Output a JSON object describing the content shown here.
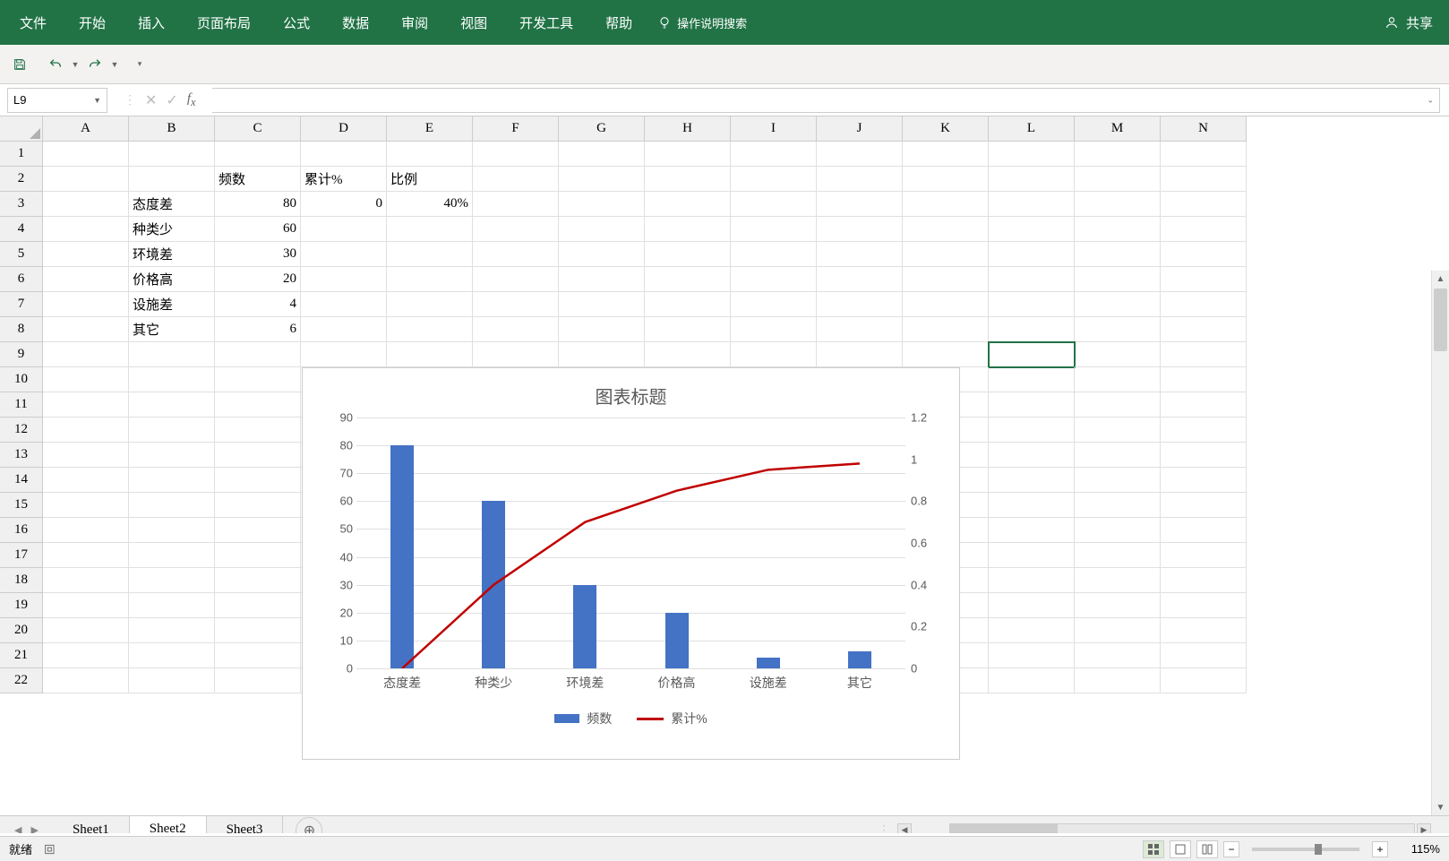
{
  "ribbon": {
    "items": [
      "文件",
      "开始",
      "插入",
      "页面布局",
      "公式",
      "数据",
      "审阅",
      "视图",
      "开发工具",
      "帮助"
    ],
    "tell_me": "操作说明搜索",
    "share": "共享"
  },
  "name_box": "L9",
  "formula": "",
  "columns": [
    "A",
    "B",
    "C",
    "D",
    "E",
    "F",
    "G",
    "H",
    "I",
    "J",
    "K",
    "L",
    "M",
    "N"
  ],
  "row_count": 22,
  "active_cell": {
    "col": 11,
    "row": 8
  },
  "table": {
    "headers": {
      "freq": "频数",
      "cum": "累计%",
      "ratio": "比例"
    },
    "rows": [
      {
        "label": "态度差",
        "freq": 80,
        "cum": 0,
        "ratio": "40%"
      },
      {
        "label": "种类少",
        "freq": 60
      },
      {
        "label": "环境差",
        "freq": 30
      },
      {
        "label": "价格高",
        "freq": 20
      },
      {
        "label": "设施差",
        "freq": 4
      },
      {
        "label": "其它",
        "freq": 6
      }
    ]
  },
  "chart_data": {
    "type": "combo-bar-line",
    "title": "图表标题",
    "categories": [
      "态度差",
      "种类少",
      "环境差",
      "价格高",
      "设施差",
      "其它"
    ],
    "series": [
      {
        "name": "频数",
        "type": "bar",
        "axis": "left",
        "values": [
          80,
          60,
          30,
          20,
          4,
          6
        ],
        "color": "#4472C4"
      },
      {
        "name": "累计%",
        "type": "line",
        "axis": "right",
        "values": [
          0,
          0.4,
          0.7,
          0.85,
          0.95,
          0.98
        ],
        "color": "#C00000"
      }
    ],
    "y_left": {
      "min": 0,
      "max": 90,
      "ticks": [
        0,
        10,
        20,
        30,
        40,
        50,
        60,
        70,
        80,
        90
      ]
    },
    "y_right": {
      "min": 0,
      "max": 1.2,
      "ticks": [
        0,
        0.2,
        0.4,
        0.6,
        0.8,
        1,
        1.2
      ]
    },
    "legend": [
      "频数",
      "累计%"
    ]
  },
  "sheets": {
    "list": [
      "Sheet1",
      "Sheet2",
      "Sheet3"
    ],
    "active": "Sheet2"
  },
  "status": {
    "ready": "就绪",
    "zoom": "115%"
  }
}
